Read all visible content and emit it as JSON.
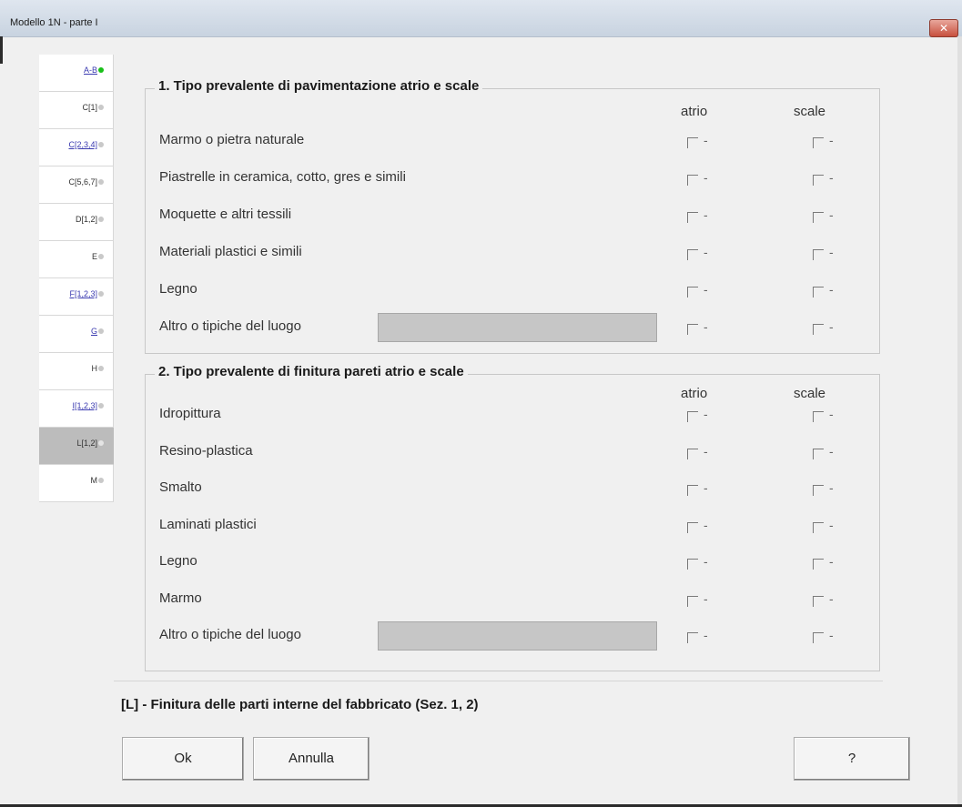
{
  "window": {
    "title": "Modello 1N  -  parte I",
    "close_glyph": "✕"
  },
  "tabs": [
    {
      "label": "A-B",
      "status": "green",
      "link": true,
      "selected": false
    },
    {
      "label": "C[1]",
      "status": "gray",
      "link": false,
      "selected": false
    },
    {
      "label": "C[2,3,4]",
      "status": "gray",
      "link": true,
      "selected": false
    },
    {
      "label": "C[5,6,7]",
      "status": "gray",
      "link": false,
      "selected": false
    },
    {
      "label": "D[1,2]",
      "status": "gray",
      "link": false,
      "selected": false
    },
    {
      "label": "E",
      "status": "gray",
      "link": false,
      "selected": false
    },
    {
      "label": "F[1,2,3]",
      "status": "gray",
      "link": true,
      "selected": false
    },
    {
      "label": "G",
      "status": "gray",
      "link": true,
      "selected": false
    },
    {
      "label": "H",
      "status": "gray",
      "link": false,
      "selected": false
    },
    {
      "label": "I[1,2,3]",
      "status": "gray",
      "link": true,
      "selected": false
    },
    {
      "label": "L[1,2]",
      "status": "light",
      "link": false,
      "selected": true
    },
    {
      "label": "M",
      "status": "gray",
      "link": false,
      "selected": false
    }
  ],
  "section1": {
    "title": "1. Tipo prevalente di pavimentazione atrio e scale",
    "col_atrio": "atrio",
    "col_scale": "scale",
    "rows": [
      {
        "label": "Marmo o pietra naturale",
        "atrio_mark": "-",
        "scale_mark": "-"
      },
      {
        "label": "Piastrelle in ceramica, cotto, gres e simili",
        "atrio_mark": "-",
        "scale_mark": "-"
      },
      {
        "label": "Moquette e altri tessili",
        "atrio_mark": "-",
        "scale_mark": "-"
      },
      {
        "label": "Materiali plastici e simili",
        "atrio_mark": "-",
        "scale_mark": "-"
      },
      {
        "label": "Legno",
        "atrio_mark": "-",
        "scale_mark": "-"
      },
      {
        "label": "Altro o tipiche del luogo",
        "atrio_mark": "-",
        "scale_mark": "-",
        "has_field": true,
        "field_value": ""
      }
    ]
  },
  "section2": {
    "title": "2. Tipo prevalente di finitura pareti atrio e scale",
    "col_atrio": "atrio",
    "col_scale": "scale",
    "rows": [
      {
        "label": "Idropittura",
        "atrio_mark": "-",
        "scale_mark": "-"
      },
      {
        "label": "Resino-plastica",
        "atrio_mark": "-",
        "scale_mark": "-"
      },
      {
        "label": "Smalto",
        "atrio_mark": "-",
        "scale_mark": "-"
      },
      {
        "label": "Laminati plastici",
        "atrio_mark": "-",
        "scale_mark": "-"
      },
      {
        "label": "Legno",
        "atrio_mark": "-",
        "scale_mark": "-"
      },
      {
        "label": "Marmo",
        "atrio_mark": "-",
        "scale_mark": "-"
      },
      {
        "label": "Altro o tipiche del luogo",
        "atrio_mark": "-",
        "scale_mark": "-",
        "has_field": true,
        "field_value": ""
      }
    ]
  },
  "footer": {
    "section_desc": "[L] - Finitura delle parti interne del fabbricato (Sez. 1, 2)",
    "ok_label": "Ok",
    "cancel_label": "Annulla",
    "help_label": "?"
  }
}
